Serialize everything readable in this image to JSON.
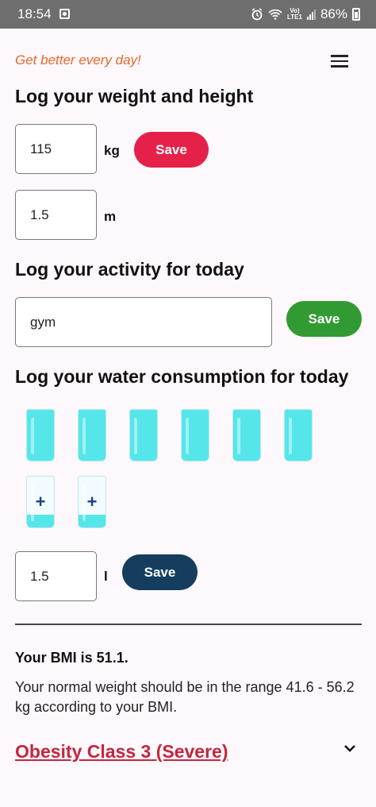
{
  "status_bar": {
    "time": "18:54",
    "network_label": "Vo) LTE1",
    "battery": "86%"
  },
  "header": {
    "tagline": "Get better every day!",
    "menu_icon": "hamburger-menu-icon"
  },
  "weight_section": {
    "title": "Log your weight and height",
    "weight_value": "115",
    "weight_unit": "kg",
    "height_value": "1.5",
    "height_unit": "m",
    "save_label": "Save",
    "save_color": "#e5214a"
  },
  "activity_section": {
    "title": "Log your activity for today",
    "activity_value": "gym",
    "save_label": "Save",
    "save_color": "#329a32"
  },
  "water_section": {
    "title": "Log your water consumption for today",
    "glasses": [
      {
        "state": "full",
        "fill": 1.0
      },
      {
        "state": "full",
        "fill": 1.0
      },
      {
        "state": "full",
        "fill": 1.0
      },
      {
        "state": "full",
        "fill": 1.0
      },
      {
        "state": "full",
        "fill": 1.0
      },
      {
        "state": "full",
        "fill": 1.0
      },
      {
        "state": "add",
        "fill": 0.25,
        "label": "+"
      },
      {
        "state": "add",
        "fill": 0.25,
        "label": "+"
      }
    ],
    "water_value": "1.5",
    "water_unit": "l",
    "save_label": "Save",
    "save_color": "#143d5e"
  },
  "bmi": {
    "title": "Your BMI is 51.1.",
    "description": "Your normal weight should be in the range 41.6 - 56.2 kg according to your BMI.",
    "classification": "Obesity Class 3 (Severe)",
    "classification_color": "#c4263f",
    "expand_icon": "chevron-down-icon"
  }
}
